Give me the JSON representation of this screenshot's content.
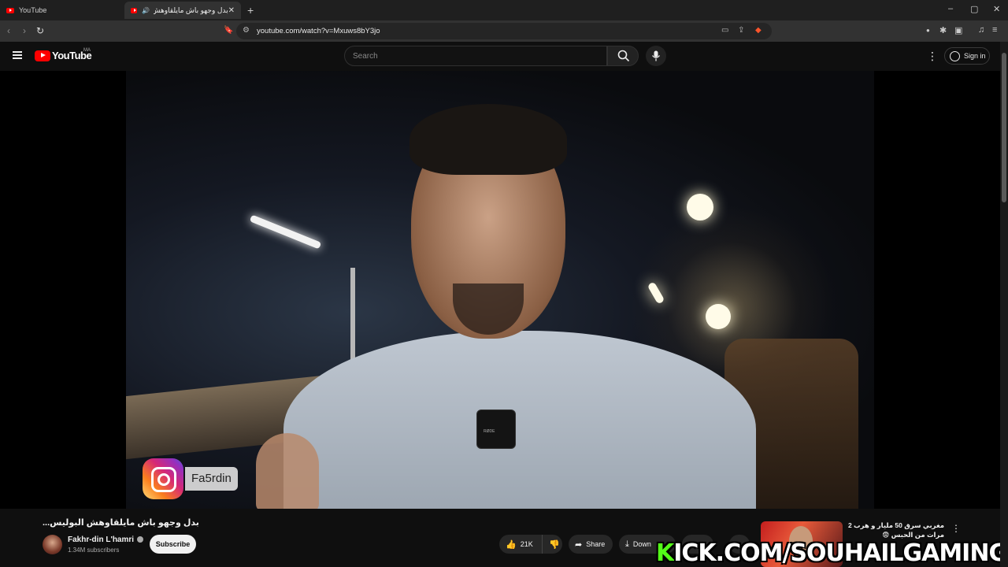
{
  "browser": {
    "tabs": [
      {
        "label": "YouTube"
      },
      {
        "label": "بدل وجهو باش مايلقاوهش البو"
      }
    ],
    "url": "youtube.com/watch?v=Mxuws8bY3jo"
  },
  "header": {
    "logo_text": "YouTube",
    "country_code": "MA",
    "search_placeholder": "Search",
    "sign_in_label": "Sign in"
  },
  "overlay": {
    "instagram_handle": "Fa5rdin",
    "mic_brand": "RØDE",
    "watermark_k": "K",
    "watermark_rest": "ICK.COM/SOUHAILGAMING"
  },
  "video": {
    "title": "...بدل وجهو باش مايلقاوهش البوليس",
    "channel_name": "Fakhr-din L'hamri",
    "subscribers": "1.34M subscribers",
    "subscribe_label": "Subscribe",
    "likes": "21K",
    "share_label": "Share",
    "download_label": "Down"
  },
  "recommendation": {
    "title": "مغربي سرق 50 مليار و هرب 2 مرات من الحبس 😨"
  },
  "colors": {
    "brand_red": "#ff0000",
    "kick_green": "#53fc18",
    "background": "#0f0f0f"
  }
}
